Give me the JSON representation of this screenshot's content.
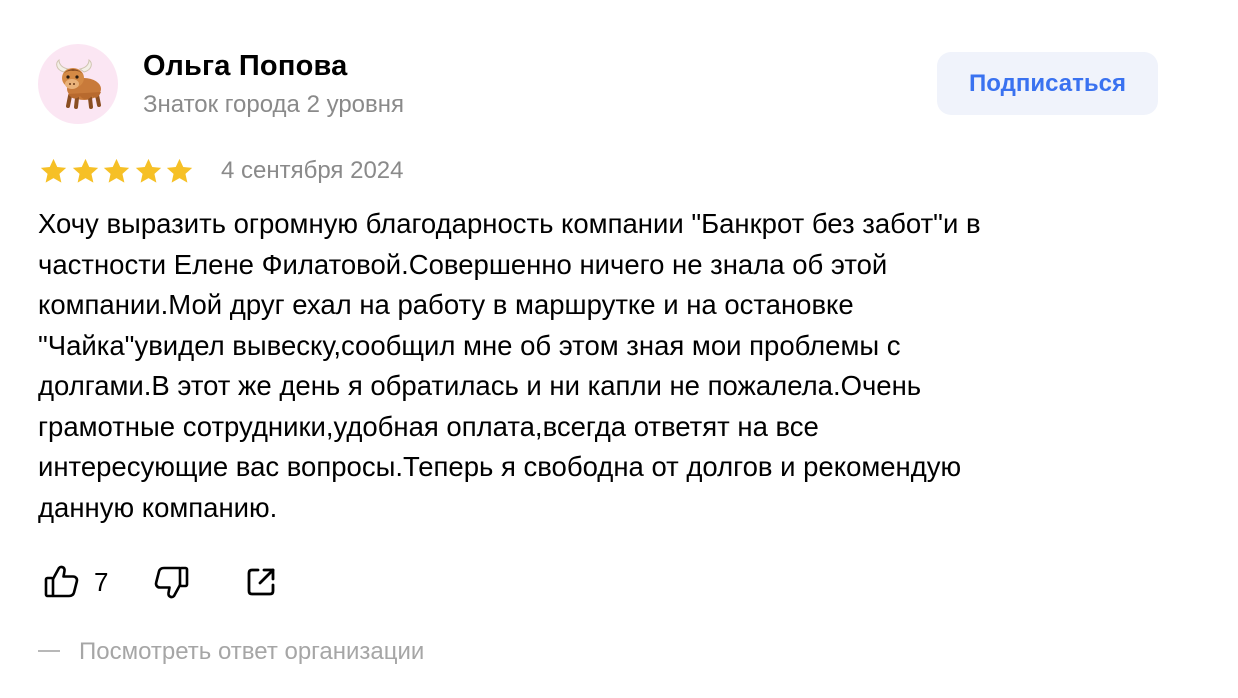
{
  "author": {
    "name": "Ольга Попова",
    "level": "Знаток города 2 уровня",
    "avatar_icon": "yak-emoji-icon",
    "avatar_bg": "#fbe6f3"
  },
  "subscribe": {
    "label": "Подписаться",
    "color": "#3a72f0",
    "bg": "#f0f3fb"
  },
  "review": {
    "rating": 5,
    "rating_max": 5,
    "star_color": "#f6c026",
    "date": "4 сентября 2024",
    "text_lines": [
      "Хочу выразить огромную благодарность компании \"Банкрот без забот\"и в",
      "частности Елене Филатовой.Совершенно ничего не знала об этой",
      "компании.Мой друг ехал на работу в маршрутке и на остановке",
      "\"Чайка\"увидел вывеску,сообщил мне об этом зная мои проблемы с",
      "долгами.В этот же день я обратилась и ни капли не пожалела.Очень",
      "грамотные сотрудники,удобная оплата,всегда ответят на все",
      "интересующие вас вопросы.Теперь я свободна от долгов и рекомендую",
      "данную компанию."
    ]
  },
  "actions": {
    "like_icon": "thumbs-up-icon",
    "like_count": "7",
    "dislike_icon": "thumbs-down-icon",
    "share_icon": "share-icon"
  },
  "org_response": {
    "label": "Посмотреть ответ организации"
  }
}
